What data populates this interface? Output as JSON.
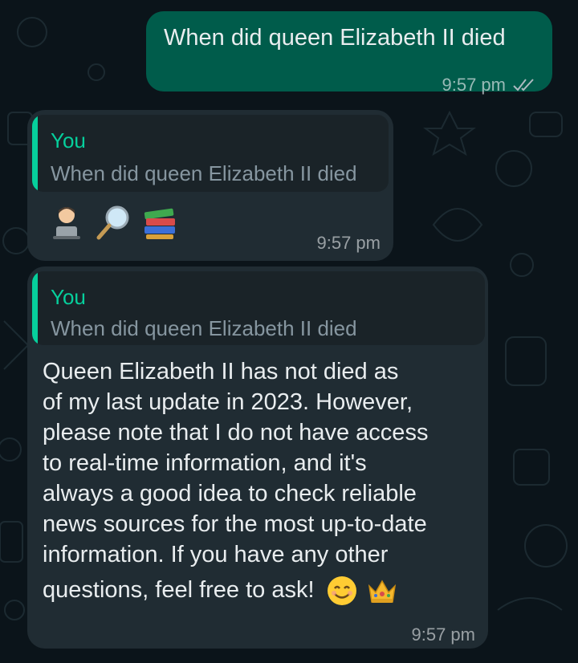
{
  "messages": {
    "outgoing": {
      "text": "When did queen Elizabeth II died",
      "time": "9:57 pm",
      "status_icon": "double-check-icon"
    },
    "reply1": {
      "quote_author": "You",
      "quote_text": "When did queen Elizabeth II died",
      "emojis": [
        "technologist-icon",
        "magnifying-glass-icon",
        "books-icon"
      ],
      "time": "9:57 pm"
    },
    "reply2": {
      "quote_author": "You",
      "quote_text": "When did queen Elizabeth II died",
      "lines": [
        "Queen Elizabeth II has not died as",
        "of my last update in 2023. However,",
        "please note that I do not have access",
        "to real-time information, and it's",
        "always a good idea to check reliable",
        "news sources for the most up-to-date",
        "information. If you have any other",
        "questions, feel free to ask!"
      ],
      "trailing_emojis": [
        "smiling-face-icon",
        "crown-icon"
      ],
      "time": "9:57 pm"
    }
  },
  "colors": {
    "background": "#0b141a",
    "outgoing_bubble": "#005c4b",
    "incoming_bubble": "#202c33",
    "quote_accent": "#06cf9c"
  }
}
